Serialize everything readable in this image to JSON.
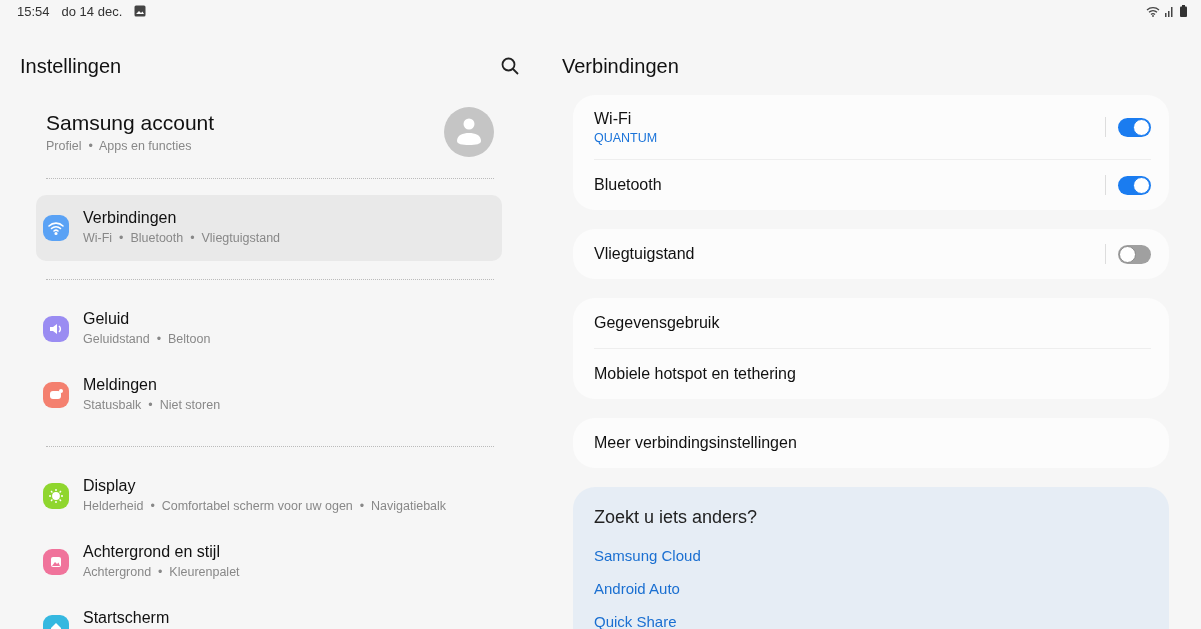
{
  "status_bar": {
    "time": "15:54",
    "date": "do 14 dec."
  },
  "sidebar": {
    "title": "Instellingen",
    "account": {
      "name": "Samsung account",
      "subtitle": "Profiel  •  Apps en functies"
    },
    "groups": [
      {
        "items": [
          {
            "kind": "wifi",
            "title": "Verbindingen",
            "subtitle": "Wi-Fi  •  Bluetooth  •  Vliegtuigstand",
            "color": "#5aa2f5",
            "selected": true
          }
        ]
      },
      {
        "items": [
          {
            "kind": "sound",
            "title": "Geluid",
            "subtitle": "Geluidstand  •  Beltoon",
            "color": "#9a8cf2",
            "selected": false
          },
          {
            "kind": "notifications",
            "title": "Meldingen",
            "subtitle": "Statusbalk  •  Niet storen",
            "color": "#f4806f",
            "selected": false
          }
        ]
      },
      {
        "items": [
          {
            "kind": "display",
            "title": "Display",
            "subtitle": "Helderheid  •  Comfortabel scherm voor uw ogen  •  Navigatiebalk",
            "color": "#8fd62e",
            "selected": false
          },
          {
            "kind": "wallpaper",
            "title": "Achtergrond en stijl",
            "subtitle": "Achtergrond  •  Kleurenpalet",
            "color": "#f0739b",
            "selected": false
          },
          {
            "kind": "home",
            "title": "Startscherm",
            "color": "#35b8e0",
            "selected": false
          }
        ]
      }
    ]
  },
  "detail": {
    "title": "Verbindingen",
    "cards": [
      {
        "rows": [
          {
            "kind": "toggle",
            "title": "Wi-Fi",
            "subtitle": "QUANTUM",
            "on": true
          },
          {
            "kind": "toggle",
            "title": "Bluetooth",
            "on": true
          }
        ]
      },
      {
        "rows": [
          {
            "kind": "toggle",
            "title": "Vliegtuigstand",
            "on": false
          }
        ]
      },
      {
        "rows": [
          {
            "kind": "link",
            "title": "Gegevensgebruik"
          },
          {
            "kind": "link",
            "title": "Mobiele hotspot en tethering"
          }
        ]
      },
      {
        "rows": [
          {
            "kind": "link",
            "title": "Meer verbindingsinstellingen"
          }
        ]
      }
    ],
    "suggestions": {
      "title": "Zoekt u iets anders?",
      "links": [
        "Samsung Cloud",
        "Android Auto",
        "Quick Share"
      ]
    }
  }
}
